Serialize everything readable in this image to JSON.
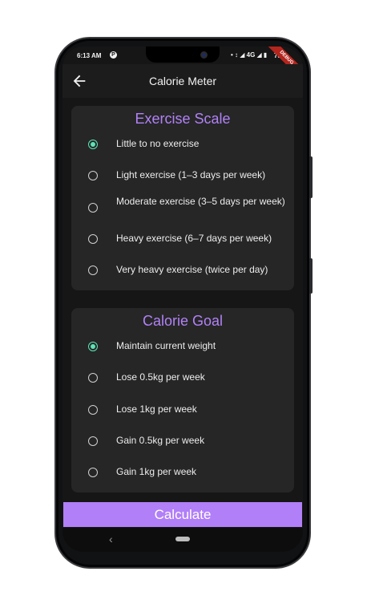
{
  "status_bar": {
    "time": "6:13 AM",
    "app_icon": "P",
    "icons": "• ↕ ◢ 4G ◢ ▮",
    "battery": "78%",
    "debug_banner": "DEBUG"
  },
  "app_bar": {
    "back_icon": "arrow-back-icon",
    "title": "Calorie Meter"
  },
  "exercise_scale": {
    "title": "Exercise Scale",
    "options": [
      {
        "label": "Little to no exercise",
        "selected": true
      },
      {
        "label": "Light exercise (1–3 days per week)",
        "selected": false
      },
      {
        "label": "Moderate exercise (3–5 days per week)",
        "selected": false
      },
      {
        "label": "Heavy exercise (6–7 days per week)",
        "selected": false
      },
      {
        "label": "Very heavy exercise (twice per day)",
        "selected": false
      }
    ]
  },
  "calorie_goal": {
    "title": "Calorie Goal",
    "options": [
      {
        "label": "Maintain current weight",
        "selected": true
      },
      {
        "label": "Lose 0.5kg per week",
        "selected": false
      },
      {
        "label": "Lose 1kg per week",
        "selected": false
      },
      {
        "label": "Gain 0.5kg per week",
        "selected": false
      },
      {
        "label": "Gain 1kg per week",
        "selected": false
      }
    ]
  },
  "actions": {
    "calculate_label": "Calculate"
  },
  "nav_bar": {
    "back_glyph": "‹"
  },
  "colors": {
    "accent": "#b17ff8",
    "radio_selected": "#5fe3b7",
    "background": "#161616",
    "card": "#262626"
  }
}
